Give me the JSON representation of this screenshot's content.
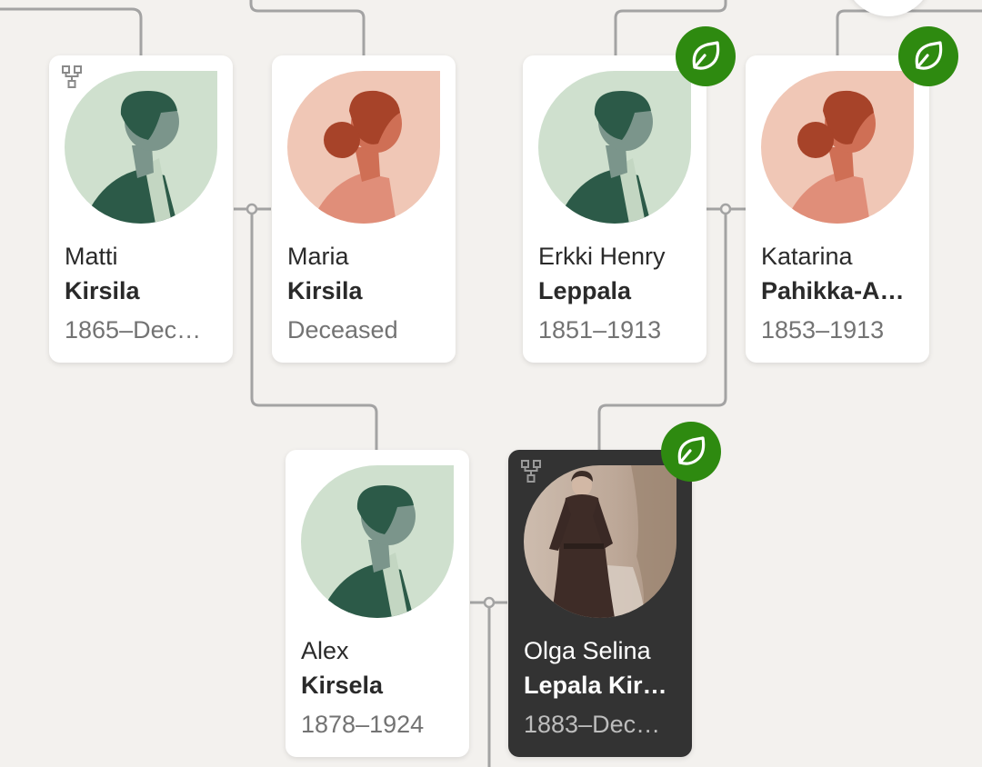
{
  "people": {
    "matti": {
      "given": "Matti",
      "surname": "Kirsila",
      "dates": "1865–Dec…",
      "avatar": "male-silhouette"
    },
    "maria": {
      "given": "Maria",
      "surname": "Kirsila",
      "dates": "Deceased",
      "avatar": "female-silhouette"
    },
    "erkki": {
      "given": "Erkki Henry",
      "surname": "Leppala",
      "dates": "1851–1913",
      "avatar": "male-silhouette",
      "hint": true
    },
    "katarina": {
      "given": "Katarina",
      "surname": "Pahikka-A…",
      "dates": "1853–1913",
      "avatar": "female-silhouette",
      "hint": true
    },
    "alex": {
      "given": "Alex",
      "surname": "Kirsela",
      "dates": "1878–1924",
      "avatar": "male-silhouette"
    },
    "olga": {
      "given": "Olga Selina",
      "surname": "Lepala Kir…",
      "dates": "1883–Dec…",
      "avatar": "photo",
      "hint": true,
      "selected": true
    }
  },
  "icons": {
    "hint": "leaf-hint-icon",
    "family_tree": "family-tree-icon"
  },
  "colors": {
    "background": "#f3f1ee",
    "card": "#ffffff",
    "selected_card": "#333333",
    "hint_badge": "#2e8a10",
    "connector": "#a3a3a3",
    "male_bg": "#cfe0ce",
    "male_figure": "#2c5a48",
    "female_bg": "#f0c7b6",
    "female_figure": "#cf6f55"
  }
}
